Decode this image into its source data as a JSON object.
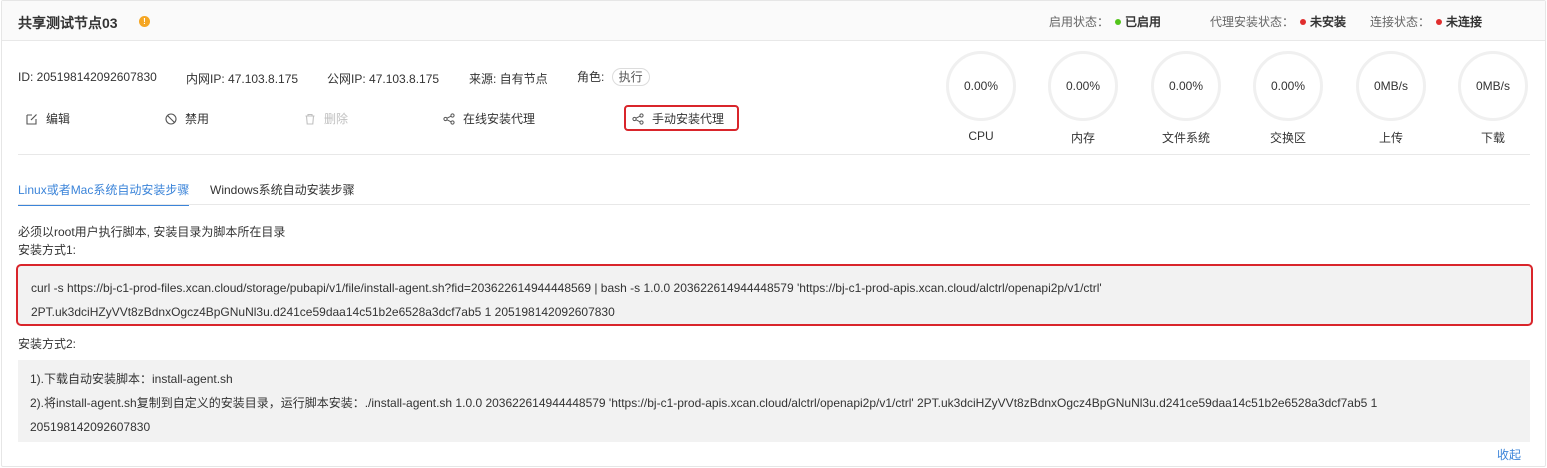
{
  "header": {
    "title": "共享测试节点03",
    "info_icon": "info-circle-icon",
    "enable_status": {
      "label": "启用状态：",
      "value": "已启用",
      "color": "#52c41a"
    },
    "agent_status": {
      "label": "代理安装状态：",
      "value": "未安装",
      "color": "#e02d2d"
    },
    "connect_status": {
      "label": "连接状态：",
      "value": "未连接",
      "color": "#e02d2d"
    }
  },
  "meta": {
    "id_label": "ID: ",
    "id_value": "205198142092607830",
    "private_ip_label": "内网IP: ",
    "private_ip_value": "47.103.8.175",
    "public_ip_label": "公网IP: ",
    "public_ip_value": "47.103.8.175",
    "source_label": "来源: ",
    "source_value": "自有节点",
    "role_label": "角色: ",
    "role_value": "执行"
  },
  "actions": {
    "edit": "编辑",
    "disable": "禁用",
    "delete": "删除",
    "online_install": "在线安装代理",
    "manual_install": "手动安装代理"
  },
  "gauges": [
    {
      "value": "0.00%",
      "label": "CPU"
    },
    {
      "value": "0.00%",
      "label": "内存"
    },
    {
      "value": "0.00%",
      "label": "文件系统"
    },
    {
      "value": "0.00%",
      "label": "交换区"
    },
    {
      "value": "0MB/s",
      "label": "上传"
    },
    {
      "value": "0MB/s",
      "label": "下载"
    }
  ],
  "tabs": {
    "linux": "Linux或者Mac系统自动安装步骤",
    "windows": "Windows系统自动安装步骤"
  },
  "notes": {
    "root_note": "必须以root用户执行脚本, 安装目录为脚本所在目录",
    "method1": "安装方式1:",
    "method2": "安装方式2:"
  },
  "method1_code": {
    "line1": "curl -s https://bj-c1-prod-files.xcan.cloud/storage/pubapi/v1/file/install-agent.sh?fid=203622614944448569 | bash -s 1.0.0 203622614944448579 'https://bj-c1-prod-apis.xcan.cloud/alctrl/openapi2p/v1/ctrl'",
    "line2": "2PT.uk3dciHZyVVt8zBdnxOgcz4BpGNuNl3u.d241ce59daa14c51b2e6528a3dcf7ab5 1 205198142092607830"
  },
  "method2_code": {
    "line1": "1).下载自动安装脚本：install-agent.sh",
    "line2": "2).将install-agent.sh复制到自定义的安装目录，运行脚本安装：./install-agent.sh 1.0.0 203622614944448579 'https://bj-c1-prod-apis.xcan.cloud/alctrl/openapi2p/v1/ctrl' 2PT.uk3dciHZyVVt8zBdnxOgcz4BpGNuNl3u.d241ce59daa14c51b2e6528a3dcf7ab5 1",
    "line3": "205198142092607830"
  },
  "collapse": "收起",
  "colors": {
    "accent": "#3b84d9",
    "highlight": "#d9252b",
    "warning": "#f5a623"
  }
}
